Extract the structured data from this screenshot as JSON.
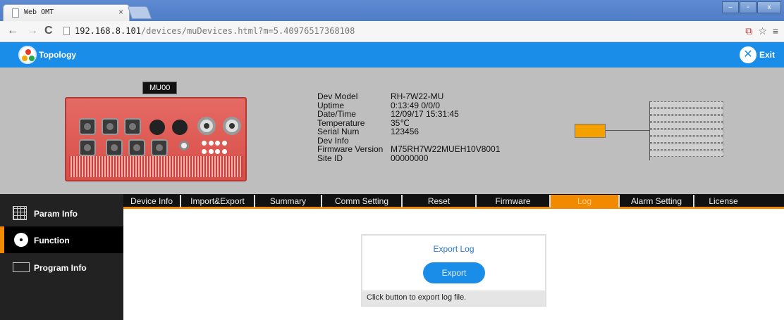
{
  "browser": {
    "tab_title": "Web OMT",
    "tab_close": "×",
    "url_host": "192.168.8.101",
    "url_rest": "/devices/muDevices.html?m=5.40976517368108",
    "win_min": "–",
    "win_max": "▫",
    "win_close": "x"
  },
  "header": {
    "topology_label": "Topology",
    "exit_label": "Exit"
  },
  "device": {
    "name_badge": "MU00",
    "info": [
      {
        "key": "Dev Model",
        "value": "RH-7W22-MU"
      },
      {
        "key": "Uptime",
        "value": "0:13:49 0/0/0"
      },
      {
        "key": "Date/Time",
        "value": "12/09/17 15:31:45"
      },
      {
        "key": "Temperature",
        "value": "35℃"
      },
      {
        "key": "Serial Num",
        "value": "123456"
      },
      {
        "key": "Dev Info",
        "value": ""
      },
      {
        "key": "Firmware Version",
        "value": "M75RH7W22MUEH10V8001"
      },
      {
        "key": "Site ID",
        "value": "00000000"
      }
    ],
    "topology_node_color": "#f4a100"
  },
  "tabs": [
    {
      "label": "Device Info",
      "width": 82
    },
    {
      "label": "Import&Export",
      "width": 105
    },
    {
      "label": "Summary",
      "width": 95
    },
    {
      "label": "Comm Setting",
      "width": 114
    },
    {
      "label": "Reset",
      "width": 105
    },
    {
      "label": "Firmware",
      "width": 105
    },
    {
      "label": "Log",
      "width": 98,
      "active": true
    },
    {
      "label": "Alarm Setting",
      "width": 106
    },
    {
      "label": "License",
      "width": 82
    }
  ],
  "sidebar": {
    "items": [
      {
        "label": "Param Info"
      },
      {
        "label": "Function"
      },
      {
        "label": "Program Info"
      }
    ]
  },
  "log": {
    "title": "Export Log",
    "button": "Export",
    "hint": "Click button to export log file."
  },
  "colors": {
    "accent_blue": "#1a8de8",
    "accent_orange": "#f28a00"
  }
}
